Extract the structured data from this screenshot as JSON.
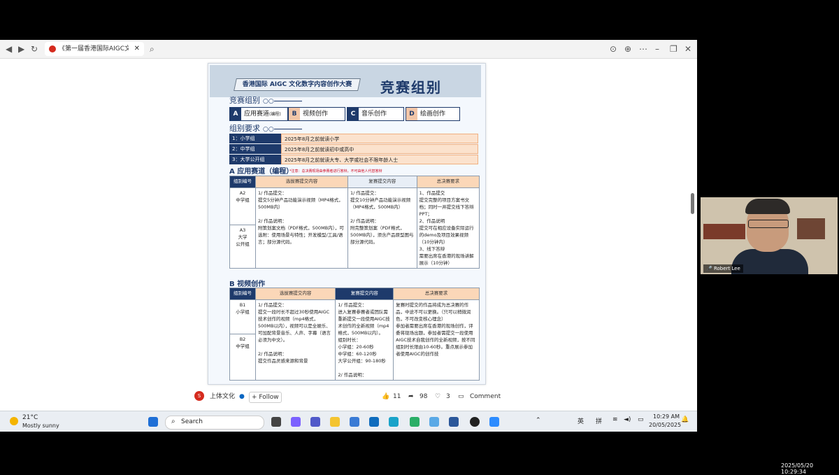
{
  "browser": {
    "tab_title": "《第一届香港国际AIGC文化...",
    "close_glyph": "✕"
  },
  "poster": {
    "banner": "香港国际 AIGC 文化数字内容创作大赛",
    "big_title": "竞赛组别",
    "section_categories": "竞赛组别",
    "categories": [
      {
        "letter": "A",
        "label": "应用赛道",
        "sub": "(编程)"
      },
      {
        "letter": "B",
        "label": "视频创作",
        "sub": ""
      },
      {
        "letter": "C",
        "label": "音乐创作",
        "sub": ""
      },
      {
        "letter": "D",
        "label": "绘画创作",
        "sub": ""
      }
    ],
    "section_requirements": "组别要求",
    "requirements": [
      {
        "key": "1：小学组",
        "value": "2025年8月之前就读小学"
      },
      {
        "key": "2：中学组",
        "value": "2025年8月之前就读初中或高中"
      },
      {
        "key": "3：大学公开组",
        "value": "2025年8月之前就读大专、大学或社会不限年龄人士"
      }
    ],
    "groupA": {
      "title": "A 应用赛道（编程）",
      "note": "*注意：总决赛现场由参赛者进行答辩，不可由他人代替答辩",
      "headers": [
        "组别编号",
        "选拔赛提交内容",
        "复赛提交内容",
        "总决赛要求"
      ],
      "codes": [
        "A2\n中学组",
        "A3\n大学\n公开组"
      ],
      "col1": "1/ 作品提交：\n提交5分钟产品功能演示视频（MP4格式，500MB内）\n\n2/ 作品说明：\n附策划案文档（PDF格式，500MB内），可选附：使用场景与特性；开发模型/工具/语言；部分源代码。",
      "col2": "1/ 作品提交：\n提交10分钟产品功能演示视频（MP4格式，500MB内）\n\n2/ 作品说明：\n附完整策划案（PDF格式，500MB内），须含产品原型图与部分源代码。",
      "col3": "1、作品提交\n提交完整的项目方案书文档；同时一并提交线下答辩PPT；\n2、作品说明\n提交可在相应设备实际运行的demo及项目效果视频（10分钟内）\n3、线下答辩\n需要出席在香港的现场讲解展示（10分钟）"
    },
    "groupB": {
      "title": "B 视频创作",
      "headers": [
        "组别编号",
        "选拔赛提交内容",
        "复赛提交内容",
        "总决赛要求"
      ],
      "codes": [
        "B1\n小学组",
        "B2\n中学组"
      ],
      "col1": "1/ 作品提交：\n提交一段时长不超过30秒使用AIGC技术创作的视频（mp4格式，500MB以内），视频可以是全娱乐、可加配背景音乐、人声、字幕（语言必须为中文）。\n\n2/ 作品说明：\n提交作品灵感来源和背景",
      "col2": "1/ 作品提交：\n进入复赛参赛者或团队需重新提交一段使用AIGC技术创作的全新视频（mp4格式，500MB以内）。\n组别时长：\n小学组：20-60秒\n中学组：60-120秒\n大学公开组：90-180秒\n\n2/ 作品说明：",
      "col3": "复赛时提交的作品将成为总决赛的作品，中途不可以更换。（只可以稍微润色，不可改变核心理念）\n参加者需要出席在香港的现场创作，评委将现场出题，参加者需提交一段使用AIGC技术自我创作的全新视频，按不同组别时长限由10-60秒。重点展示参加者使用AIGC的创作技"
    }
  },
  "post": {
    "account": "上体文化",
    "follow": "+ Follow",
    "likes": "11",
    "reposts": "98",
    "hearts": "3",
    "comment": "Comment"
  },
  "taskbar": {
    "temp": "21°C",
    "weather": "Mostly sunny",
    "search": "Search",
    "ime1": "英",
    "ime2": "拼",
    "time": "10:29 AM",
    "date": "20/05/2025"
  },
  "video": {
    "name": "Robert Lee"
  },
  "timestamp": "2025/05/20 10:29:34"
}
